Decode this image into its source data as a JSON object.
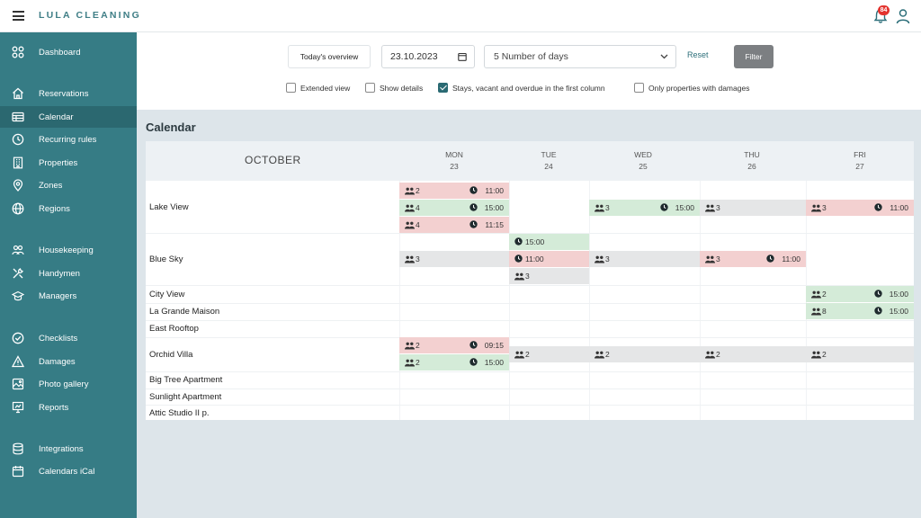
{
  "app": {
    "logo": "LULA CLEANING",
    "notifications": "84"
  },
  "sidebar": {
    "items": [
      {
        "label": "Dashboard",
        "icon": "grid-icon"
      },
      {
        "label": "Reservations",
        "icon": "home-icon"
      },
      {
        "label": "Calendar",
        "icon": "calendar-table-icon",
        "active": true
      },
      {
        "label": "Recurring rules",
        "icon": "clock-icon"
      },
      {
        "label": "Properties",
        "icon": "building-icon"
      },
      {
        "label": "Zones",
        "icon": "location-pin-icon"
      },
      {
        "label": "Regions",
        "icon": "globe-icon"
      },
      {
        "label": "Housekeeping",
        "icon": "people-icon"
      },
      {
        "label": "Handymen",
        "icon": "tools-icon"
      },
      {
        "label": "Managers",
        "icon": "graduation-cap-icon"
      },
      {
        "label": "Checklists",
        "icon": "check-circle-icon"
      },
      {
        "label": "Damages",
        "icon": "warning-icon"
      },
      {
        "label": "Photo gallery",
        "icon": "image-icon"
      },
      {
        "label": "Reports",
        "icon": "presentation-icon"
      },
      {
        "label": "Integrations",
        "icon": "database-icon"
      },
      {
        "label": "Calendars iCal",
        "icon": "calendar-icon"
      }
    ]
  },
  "filters": {
    "overview_label": "Today's overview",
    "date_value": "23.10.2023",
    "days_value": "5 Number of days",
    "reset_label": "Reset",
    "filter_label": "Filter",
    "options": [
      {
        "label": "Extended view",
        "checked": false
      },
      {
        "label": "Show details",
        "checked": false
      },
      {
        "label": "Stays, vacant and overdue in the first column",
        "checked": true
      },
      {
        "label": "Only properties with damages",
        "checked": false
      }
    ]
  },
  "calendar": {
    "title": "Calendar",
    "month": "OCTOBER",
    "days": [
      {
        "dow": "MON",
        "num": "23"
      },
      {
        "dow": "TUE",
        "num": "24"
      },
      {
        "dow": "WED",
        "num": "25"
      },
      {
        "dow": "THU",
        "num": "26"
      },
      {
        "dow": "FRI",
        "num": "27"
      }
    ],
    "properties": [
      "Lake View",
      "Blue Sky",
      "City View",
      "La Grande Maison",
      "East Rooftop",
      "Orchid Villa",
      "Big Tree Apartment",
      "Sunlight Apartment",
      "Attic Studio II p."
    ],
    "bookings": [
      {
        "property": "Lake View",
        "day": "MON",
        "status": "red",
        "guests": "2",
        "time": "11:00"
      },
      {
        "property": "Lake View",
        "day": "MON",
        "status": "green",
        "guests": "4",
        "time": "15:00"
      },
      {
        "property": "Lake View",
        "day": "MON",
        "status": "red",
        "guests": "4",
        "time": "11:15"
      },
      {
        "property": "Lake View",
        "day": "WED",
        "status": "green",
        "guests": "3",
        "time": "15:00"
      },
      {
        "property": "Lake View",
        "day": "THU",
        "status": "grey",
        "guests": "3",
        "time": ""
      },
      {
        "property": "Lake View",
        "day": "FRI",
        "status": "red",
        "guests": "3",
        "time": "11:00"
      },
      {
        "property": "Blue Sky",
        "day": "TUE",
        "status": "green",
        "guests": "",
        "time": "15:00"
      },
      {
        "property": "Blue Sky",
        "day": "MON",
        "status": "grey",
        "guests": "3",
        "time": ""
      },
      {
        "property": "Blue Sky",
        "day": "TUE",
        "status": "red",
        "guests": "",
        "time": "11:00"
      },
      {
        "property": "Blue Sky",
        "day": "WED",
        "status": "grey",
        "guests": "3",
        "time": ""
      },
      {
        "property": "Blue Sky",
        "day": "THU",
        "status": "red",
        "guests": "3",
        "time": "11:00"
      },
      {
        "property": "Blue Sky",
        "day": "TUE",
        "status": "grey",
        "guests": "3",
        "time": ""
      },
      {
        "property": "City View",
        "day": "FRI",
        "status": "green",
        "guests": "2",
        "time": "15:00"
      },
      {
        "property": "La Grande Maison",
        "day": "FRI",
        "status": "green",
        "guests": "8",
        "time": "15:00"
      },
      {
        "property": "Orchid Villa",
        "day": "MON",
        "status": "red",
        "guests": "2",
        "time": "09:15"
      },
      {
        "property": "Orchid Villa",
        "day": "TUE",
        "status": "grey",
        "guests": "2",
        "time": ""
      },
      {
        "property": "Orchid Villa",
        "day": "WED",
        "status": "grey",
        "guests": "2",
        "time": ""
      },
      {
        "property": "Orchid Villa",
        "day": "THU",
        "status": "grey",
        "guests": "2",
        "time": ""
      },
      {
        "property": "Orchid Villa",
        "day": "FRI",
        "status": "grey",
        "guests": "2",
        "time": ""
      },
      {
        "property": "Orchid Villa",
        "day": "MON",
        "status": "green",
        "guests": "2",
        "time": "15:00"
      }
    ]
  },
  "colors": {
    "sidebar": "#367c85",
    "sidebar_active": "#2b6870",
    "red": "#f3d0d0",
    "green": "#d4ebd8",
    "grey": "#e5e6e7",
    "accent": "#2d6f7a"
  }
}
